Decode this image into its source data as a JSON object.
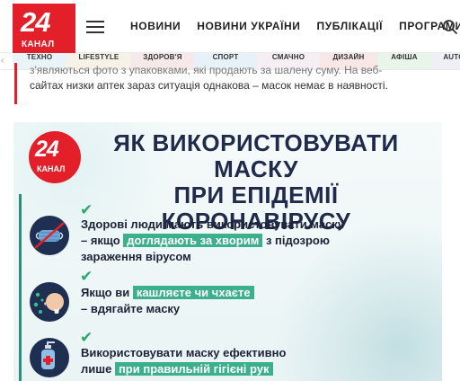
{
  "header": {
    "logo": {
      "number": "24",
      "name": "КАНАЛ"
    },
    "nav": [
      "НОВИНИ",
      "НОВИНИ УКРАЇНИ",
      "ПУБЛІКАЦІЇ",
      "ПРОГРАМИ"
    ]
  },
  "categories": [
    "ТЕХНО",
    "LIFESTYLE",
    "ЗДОРОВ'Я",
    "СПОРТ",
    "СМАЧНО",
    "ДИЗАЙН",
    "АФІША",
    "AUTO"
  ],
  "article": {
    "line1": "з'являються фото з упаковками, які продають за шалену суму. На веб-",
    "line2": "сайтах низки аптек зараз ситуація однакова – масок немає в наявності."
  },
  "infographic": {
    "logo": {
      "number": "24",
      "name": "КАНАЛ"
    },
    "title_line1": "ЯК ВИКОРИСТОВУВАТИ МАСКУ",
    "title_line2": "ПРИ ЕПІДЕМІЇ КОРОНАВІРУСУ",
    "tips": [
      {
        "pre": "Здорові люди мають використовувати маску",
        "dash": "– якщо",
        "highlight": "доглядають за хворим",
        "post": "з підозрою",
        "line3": "зараження вірусом"
      },
      {
        "pre": "Якщо ви",
        "highlight": "кашляєте чи чхаєте",
        "line2": "– вдягайте маску"
      },
      {
        "line1": "Використовувати маску ефективно",
        "pre": "лише",
        "highlight": "при правильній гігієні рук"
      }
    ]
  },
  "colors": {
    "brand": "#e3202a",
    "accent": "#3bb08a",
    "navy": "#1f2f52"
  }
}
